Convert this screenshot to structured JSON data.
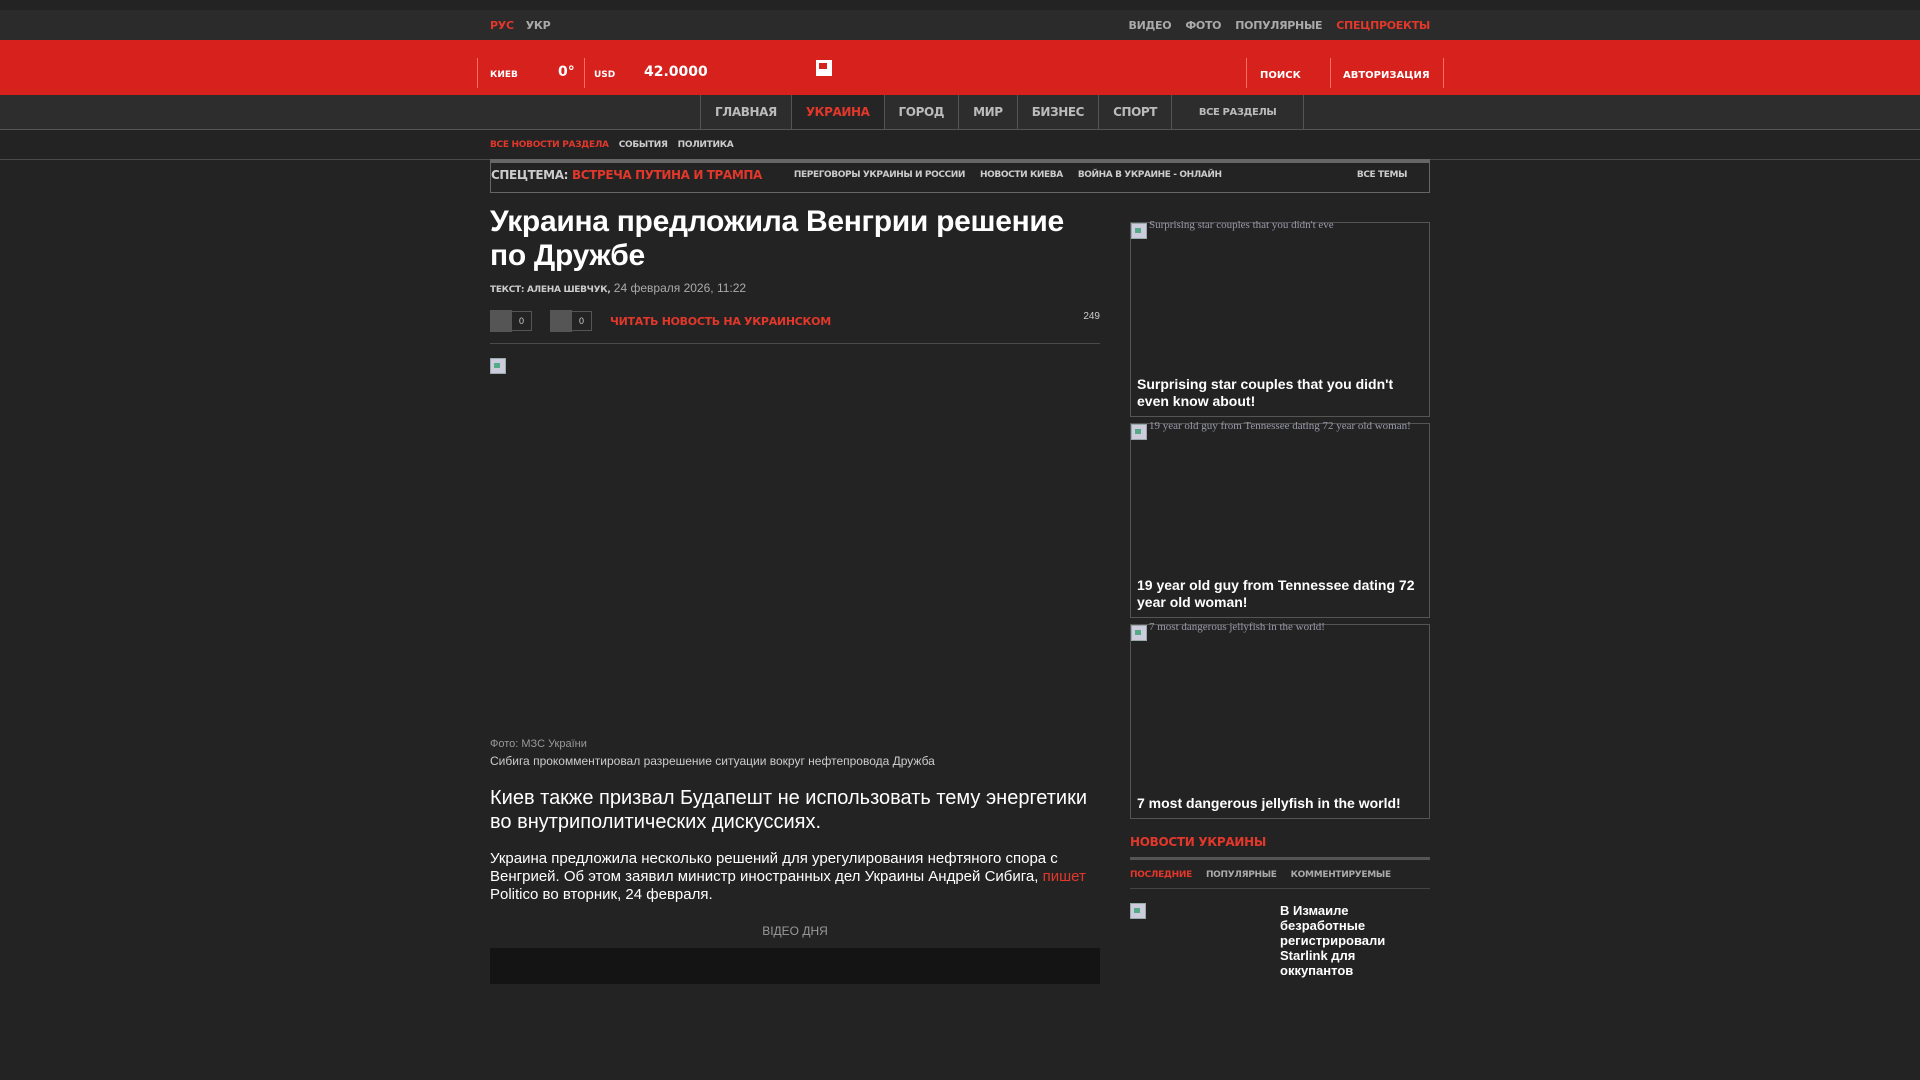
{
  "topbar": {
    "languages": [
      {
        "label": "РУС",
        "active": true
      },
      {
        "label": "УКР",
        "active": false
      }
    ],
    "links": [
      {
        "label": "ВИДЕО",
        "accent": false
      },
      {
        "label": "ФОТО",
        "accent": false
      },
      {
        "label": "ПОПУЛЯРНЫЕ",
        "accent": false
      },
      {
        "label": "СПЕЦПРОЕКТЫ",
        "accent": true
      }
    ]
  },
  "header": {
    "city": "КИЕВ",
    "temperature": "0°",
    "currency": "USD",
    "rate": "42.0000",
    "search_label": "ПОИСК",
    "auth_label": "АВТОРИЗАЦИЯ",
    "brand_color": "#d6211d"
  },
  "nav": {
    "items": [
      {
        "label": "ГЛАВНАЯ",
        "active": false
      },
      {
        "label": "УКРАИНА",
        "active": true
      },
      {
        "label": "ГОРОД",
        "active": false
      },
      {
        "label": "МИР",
        "active": false
      },
      {
        "label": "БИЗНЕС",
        "active": false
      },
      {
        "label": "СПОРТ",
        "active": false
      }
    ],
    "all_sections": "ВСЕ РАЗДЕЛЫ"
  },
  "subnav": {
    "items": [
      {
        "label": "ВСЕ НОВОСТИ РАЗДЕЛА",
        "active": true
      },
      {
        "label": "СОБЫТИЯ",
        "active": false
      },
      {
        "label": "ПОЛИТИКА",
        "active": false
      }
    ]
  },
  "spec": {
    "label": "СПЕЦТЕМА:",
    "topic": "ВСТРЕЧА ПУТИНА И ТРАМПА",
    "links": [
      "ПЕРЕГОВОРЫ УКРАИНЫ И РОССИИ",
      "НОВОСТИ КИЕВА",
      "ВОЙНА В УКРАИНЕ - ОНЛАЙН"
    ],
    "all_topics": "ВСЕ ТЕМЫ"
  },
  "article": {
    "title": "Украина предложила Венгрии решение по Дружбе",
    "author": "ТЕКСТ: АЛЕНА ШЕВЧУК,",
    "date": "24 февраля 2026, 11:22",
    "share_counts": [
      "0",
      "0"
    ],
    "read_ukrainian": "ЧИТАТЬ НОВОСТЬ НА УКРАИНСКОМ",
    "views": "249",
    "photo_credit": "Фото: МЗС України",
    "photo_caption": "Сибига прокомментировал разрешение ситуации вокруг нефтепровода Дружба",
    "lead": "Киев также призвал Будапешт не использовать тему энергетики во внутриполитических дискуссиях.",
    "body_before_link": "Украина предложила несколько решений для урегулирования нефтяного спора с Венгрией. Об этом заявил министр иностранных дел Украины Андрей Сибига,",
    "body_link": "пишет",
    "body_after_link": "Politico во вторник, 24 февраля.",
    "video_label": "ВІДЕО ДНЯ"
  },
  "sidebar": {
    "ads": [
      {
        "alt": "Surprising star couples that you didn't eve",
        "title": "Surprising star couples that you didn't even know about!"
      },
      {
        "alt": "19 year old guy from Tennessee dating 72 year old woman!",
        "title": "19 year old guy from Tennessee dating 72 year old woman!"
      },
      {
        "alt": "7 most dangerous jellyfish in the world!",
        "title": "7 most dangerous jellyfish in the world!"
      }
    ],
    "news_heading": "НОВОСТИ УКРАИНЫ",
    "tabs": [
      {
        "label": "ПОСЛЕДНИЕ",
        "active": true
      },
      {
        "label": "ПОПУЛЯРНЫЕ",
        "active": false
      },
      {
        "label": "КОММЕНТИРУЕМЫЕ",
        "active": false
      }
    ],
    "news": [
      {
        "title": "В Измаиле безработные регистрировали Starlink для оккупантов"
      }
    ]
  }
}
